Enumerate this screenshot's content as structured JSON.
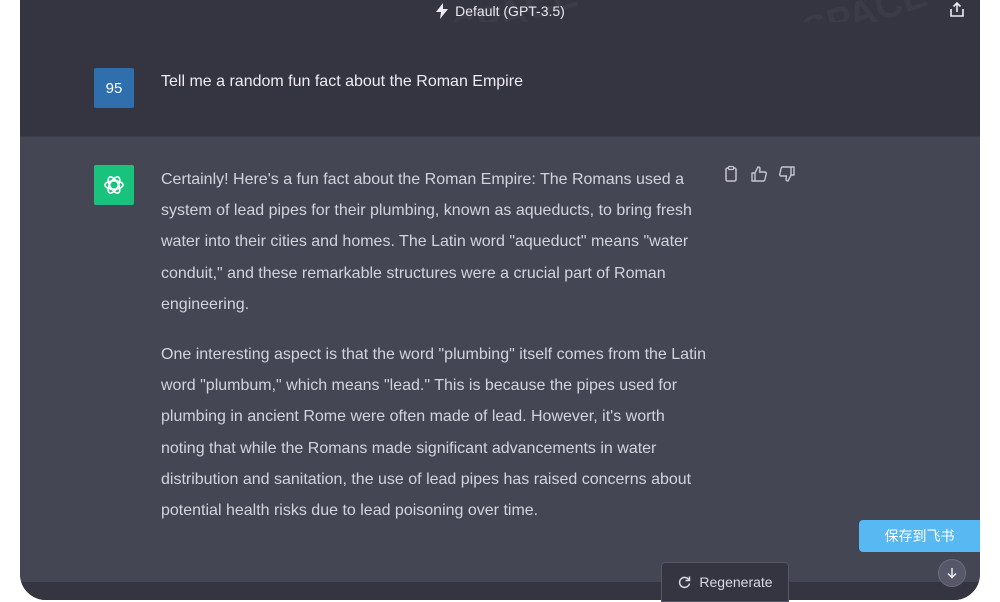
{
  "header": {
    "model_label": "Default (GPT-3.5)"
  },
  "conversation": {
    "user_avatar_text": "95",
    "user_message": "Tell me a random fun fact about the Roman Empire",
    "assistant_paragraphs": [
      "Certainly! Here's a fun fact about the Roman Empire: The Romans used a system of lead pipes for their plumbing, known as aqueducts, to bring fresh water into their cities and homes. The Latin word \"aqueduct\" means \"water conduit,\" and these remarkable structures were a crucial part of Roman engineering.",
      "One interesting aspect is that the word \"plumbing\" itself comes from the Latin word \"plumbum,\" which means \"lead.\" This is because the pipes used for plumbing in ancient Rome were often made of lead. However, it's worth noting that while the Romans made significant advancements in water distribution and sanitation, the use of lead pipes has raised concerns about potential health risks due to lead poisoning over time."
    ]
  },
  "buttons": {
    "regenerate_label": "Regenerate",
    "save_label": "保存到飞书"
  },
  "watermark_text": "AI TALENT SPACE",
  "icons": {
    "model": "lightning-icon",
    "share": "share-icon",
    "copy": "clipboard-icon",
    "like": "thumbs-up-icon",
    "dislike": "thumbs-down-icon",
    "regenerate": "refresh-icon",
    "scroll": "arrow-down-icon"
  },
  "colors": {
    "background": "#343541",
    "assistant_background": "#444654",
    "user_avatar": "#2f6fad",
    "assistant_avatar": "#19c37d",
    "save_button": "#57b8f2"
  }
}
